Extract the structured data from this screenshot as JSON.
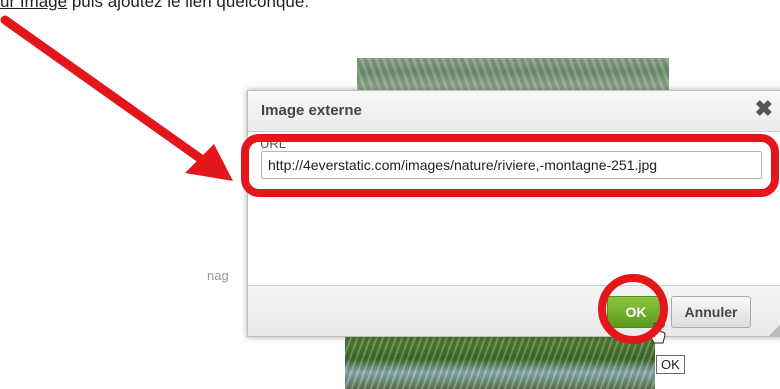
{
  "tutorial": {
    "top_text_underlined": "ur Image",
    "top_text_rest": " puis ajoutez le lien quelconque: "
  },
  "background": {
    "side_text": "nag"
  },
  "dialog": {
    "title": "Image externe",
    "close_glyph": "✖",
    "url_label": "URL",
    "url_value": "http://4everstatic.com/images/nature/riviere,-montagne-251.jpg",
    "ok_label": "OK",
    "cancel_label": "Annuler"
  },
  "tooltip": {
    "text": "OK"
  },
  "colors": {
    "annotation_red": "#e3161b",
    "ok_green": "#6aab2b"
  }
}
